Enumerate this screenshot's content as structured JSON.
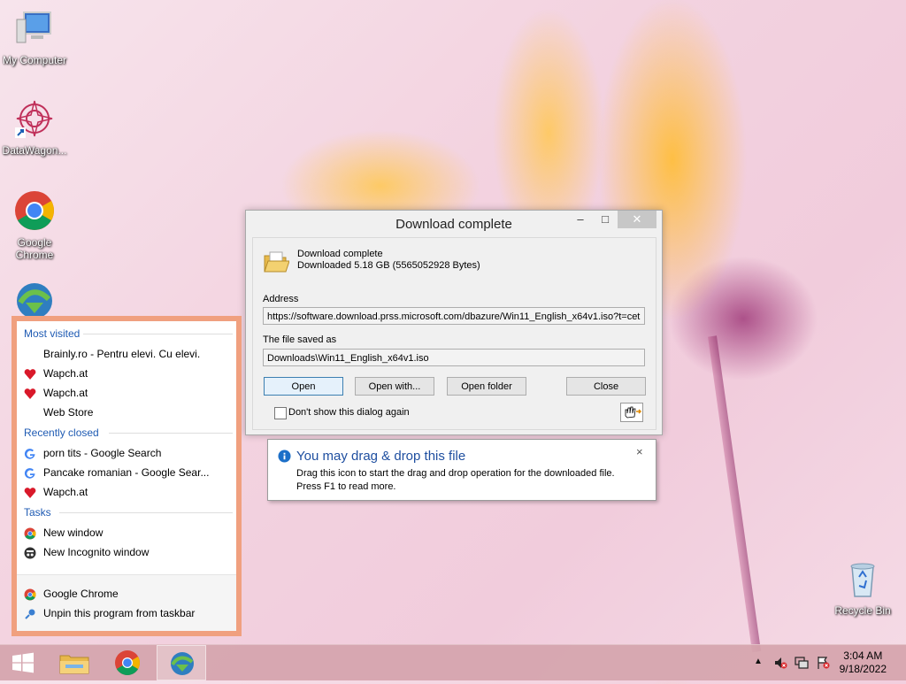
{
  "desktop": {
    "icons": [
      {
        "label": "My Computer"
      },
      {
        "label": "DataWagon..."
      },
      {
        "label": "Google Chrome"
      },
      {
        "label": "Recycle Bin"
      }
    ]
  },
  "dialog": {
    "title": "Download complete",
    "heading": "Download complete",
    "downloaded": "Downloaded 5.18  GB (5565052928 Bytes)",
    "address_label": "Address",
    "address_value": "https://software.download.prss.microsoft.com/dbazure/Win11_English_x64v1.iso?t=cet",
    "saved_label": "The file saved as",
    "saved_value": "Downloads\\Win11_English_x64v1.iso",
    "buttons": {
      "open": "Open",
      "open_with": "Open with...",
      "open_folder": "Open folder",
      "close": "Close"
    },
    "checkbox_label": "Don't show this dialog again"
  },
  "tooltip": {
    "title": "You may drag & drop this file",
    "line1": "Drag this icon to start the drag and drop operation for the downloaded file.",
    "line2": "Press F1 to read more."
  },
  "jumplist": {
    "most_visited_label": "Most visited",
    "most_visited": [
      {
        "label": "Brainly.ro - Pentru elevi. Cu elevi.",
        "icon": "none"
      },
      {
        "label": "Wapch.at",
        "icon": "heart-icon"
      },
      {
        "label": "Wapch.at",
        "icon": "heart-icon"
      },
      {
        "label": "Web Store",
        "icon": "none"
      }
    ],
    "recently_closed_label": "Recently closed",
    "recently_closed": [
      {
        "label": "porn tits - Google Search",
        "icon": "google-icon"
      },
      {
        "label": "Pancake romanian - Google Sear...",
        "icon": "google-icon"
      },
      {
        "label": "Wapch.at",
        "icon": "heart-icon"
      }
    ],
    "tasks_label": "Tasks",
    "tasks": [
      {
        "label": "New window",
        "icon": "chrome-icon"
      },
      {
        "label": "New Incognito window",
        "icon": "incognito-icon"
      }
    ],
    "footer": [
      {
        "label": "Google Chrome",
        "icon": "chrome-icon"
      },
      {
        "label": "Unpin this program from taskbar",
        "icon": "unpin-icon"
      }
    ]
  },
  "taskbar": {
    "time": "3:04 AM",
    "date": "9/18/2022"
  },
  "colors": {
    "accent_blue": "#1f5bb3",
    "jumplist_border": "#f0a07f",
    "taskbar": "#d5a4ad"
  }
}
